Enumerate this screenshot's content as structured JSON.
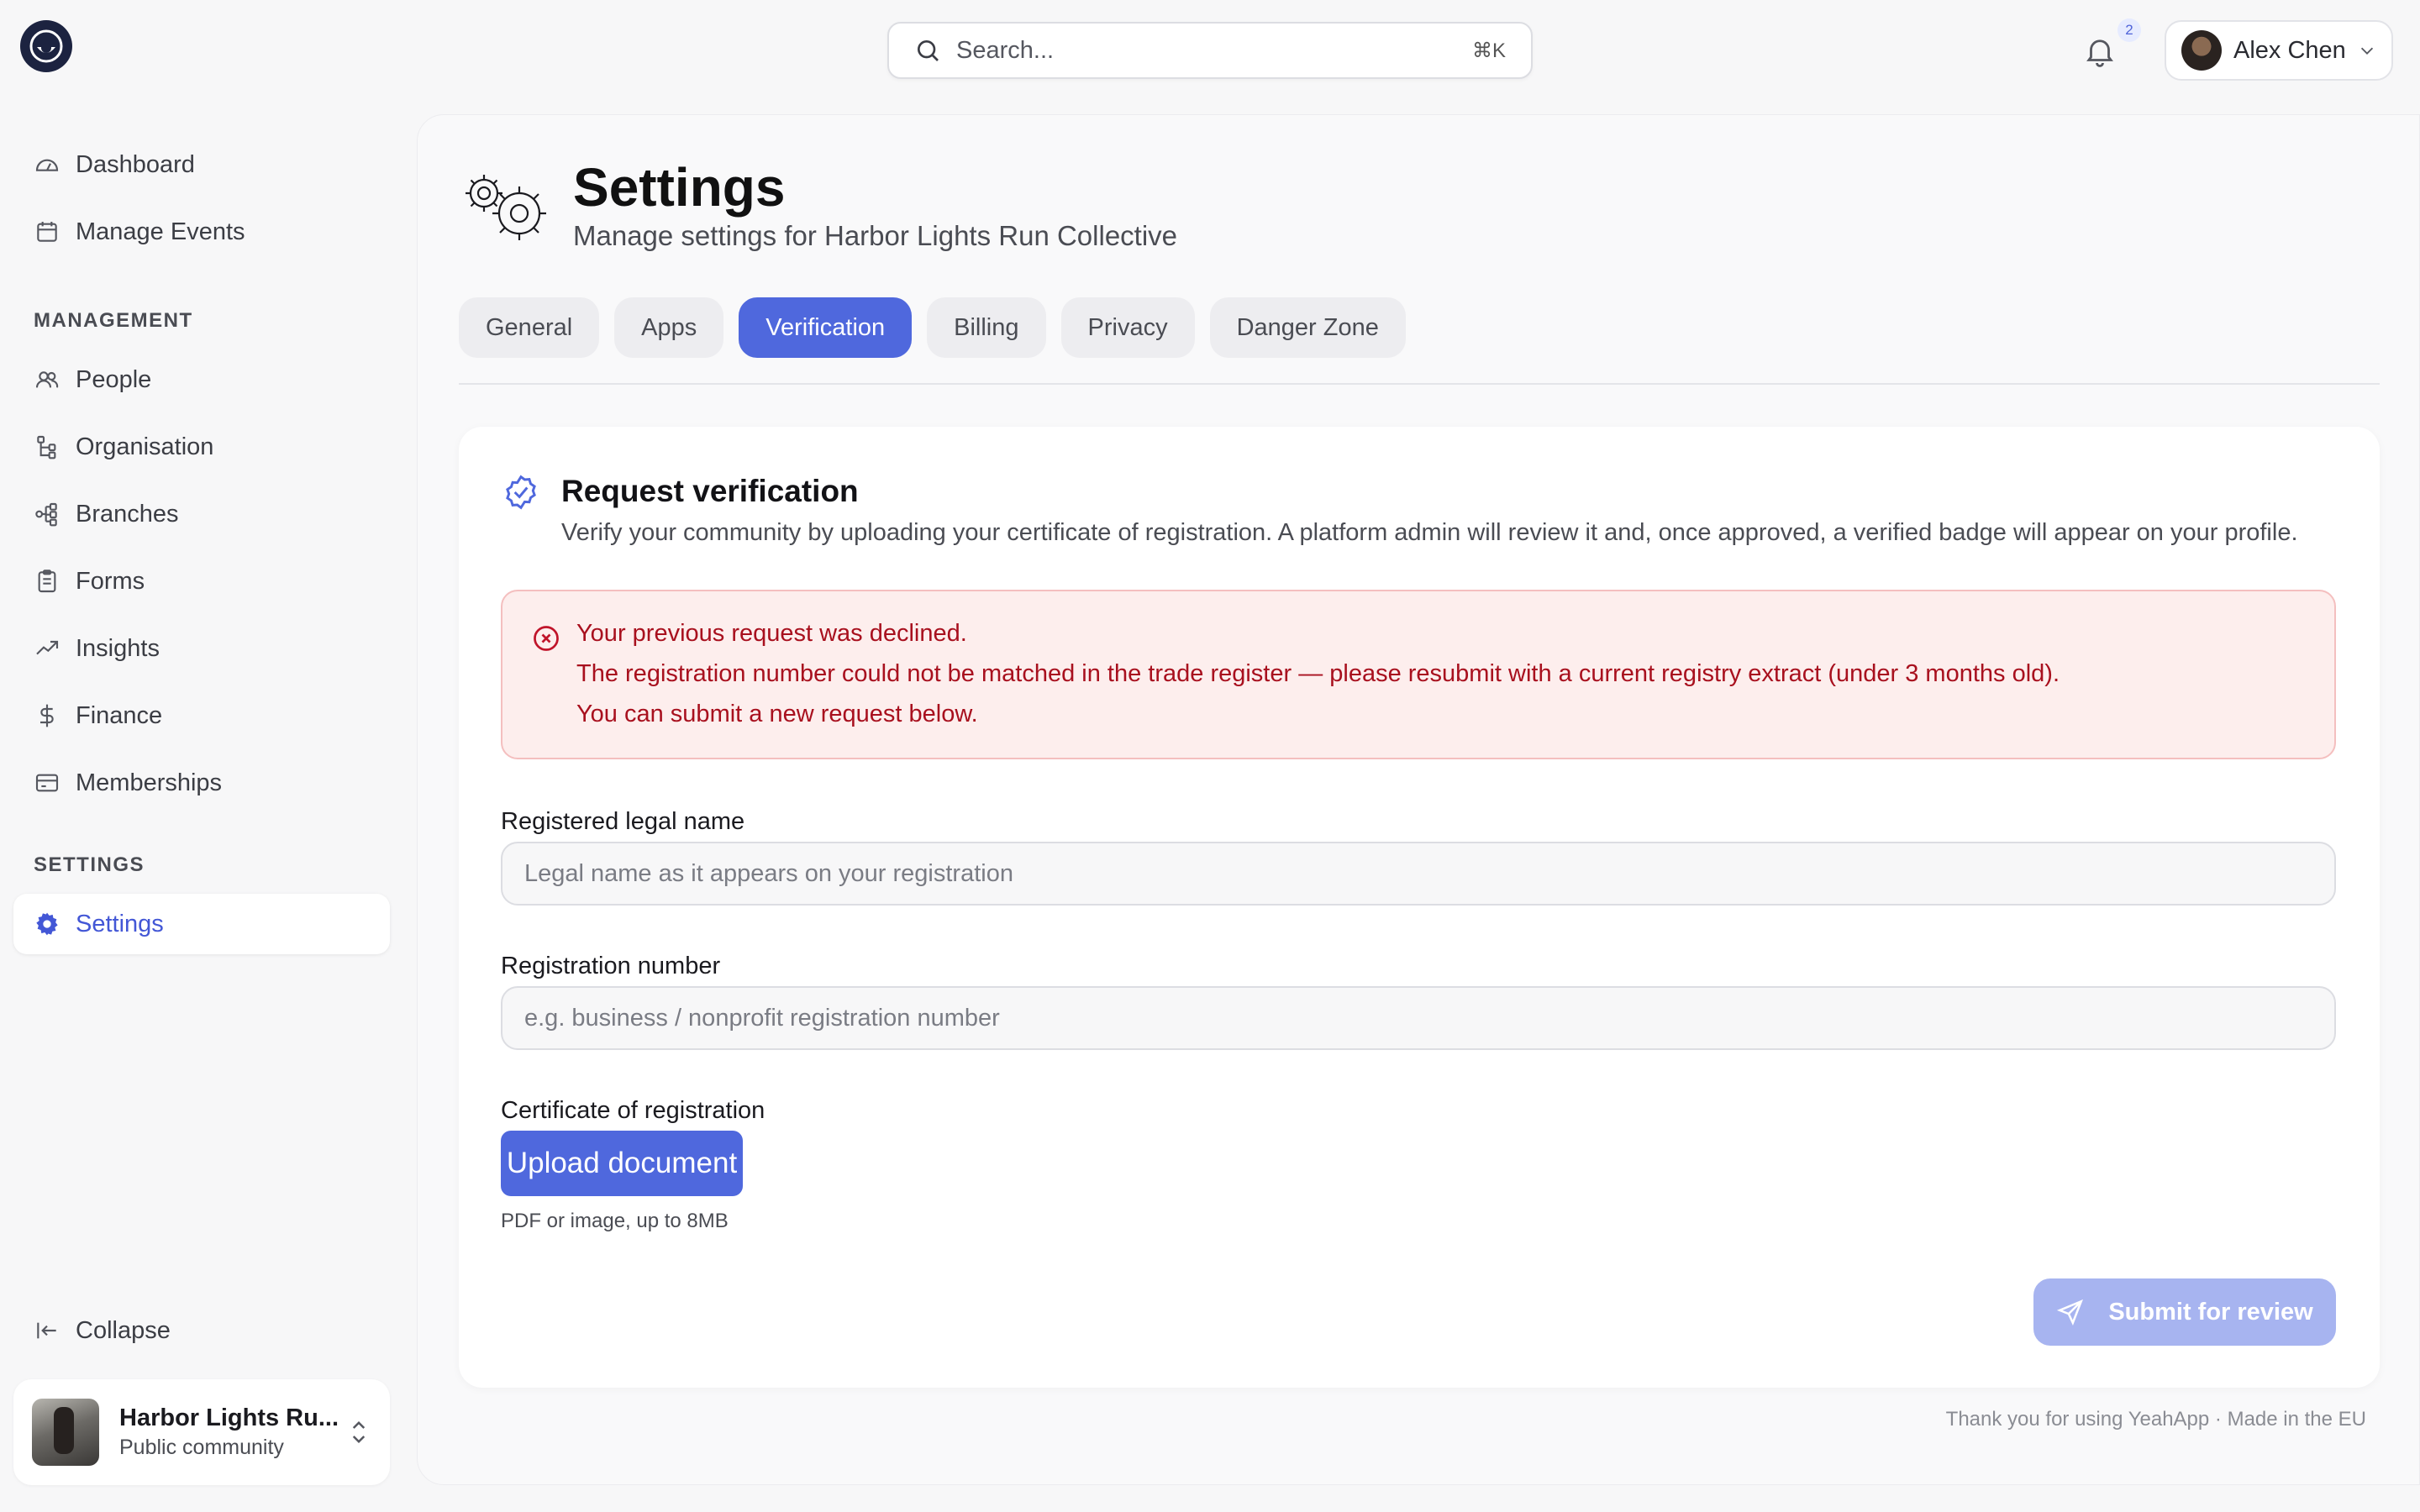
{
  "brand": {
    "logo": "eye-logo"
  },
  "search": {
    "placeholder": "Search...",
    "shortcut": "⌘K"
  },
  "notifications": {
    "count": "2"
  },
  "user": {
    "name": "Alex Chen"
  },
  "sidebar": {
    "top_items": [
      {
        "label": "Dashboard",
        "icon": "gauge-icon"
      },
      {
        "label": "Manage Events",
        "icon": "calendar-icon"
      }
    ],
    "management_heading": "MANAGEMENT",
    "management_items": [
      {
        "label": "People",
        "icon": "people-icon"
      },
      {
        "label": "Organisation",
        "icon": "org-tree-icon"
      },
      {
        "label": "Branches",
        "icon": "branches-icon"
      },
      {
        "label": "Forms",
        "icon": "clipboard-icon"
      },
      {
        "label": "Insights",
        "icon": "trend-up-icon"
      },
      {
        "label": "Finance",
        "icon": "dollar-icon"
      },
      {
        "label": "Memberships",
        "icon": "card-icon"
      }
    ],
    "settings_heading": "SETTINGS",
    "settings_item": {
      "label": "Settings",
      "icon": "gear-icon"
    },
    "collapse_label": "Collapse",
    "community": {
      "name": "Harbor Lights Ru...",
      "type": "Public community"
    }
  },
  "page": {
    "title": "Settings",
    "subtitle": "Manage settings for Harbor Lights Run Collective",
    "tabs": [
      "General",
      "Apps",
      "Verification",
      "Billing",
      "Privacy",
      "Danger Zone"
    ],
    "active_tab": "Verification"
  },
  "verification": {
    "title": "Request verification",
    "description": "Verify your community by uploading your certificate of registration. A platform admin will review it and, once approved, a verified badge will appear on your profile.",
    "alert": {
      "line1": "Your previous request was declined.",
      "line2": "The registration number could not be matched in the trade register — please resubmit with a current registry extract (under 3 months old).",
      "line3": "You can submit a new request below."
    },
    "legal_name": {
      "label": "Registered legal name",
      "value": "",
      "placeholder": "Legal name as it appears on your registration"
    },
    "reg_number": {
      "label": "Registration number",
      "value": "",
      "placeholder": "e.g. business / nonprofit registration number"
    },
    "certificate": {
      "label": "Certificate of registration",
      "button": "Upload document",
      "hint": "PDF or image, up to 8MB"
    },
    "submit_label": "Submit for review"
  },
  "footer": "Thank you for using YeahApp · Made in the EU",
  "colors": {
    "accent": "#4f68dd",
    "alert_text": "#a8101e",
    "alert_bg": "#fdeeed",
    "submit_disabled": "#a7b4f0"
  }
}
